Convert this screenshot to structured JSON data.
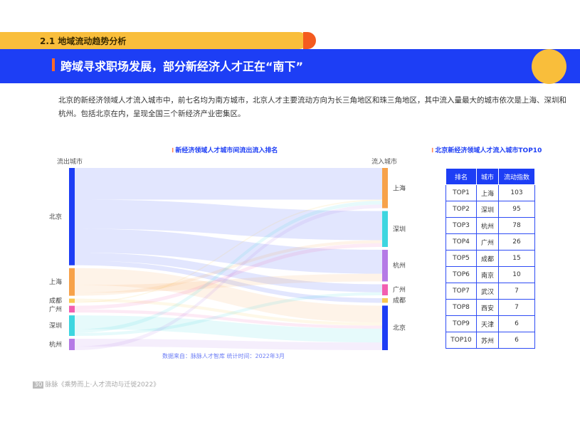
{
  "section": {
    "title": "2.1 地域流动趋势分析"
  },
  "banner": {
    "title": "跨域寻求职场发展，部分新经济人才正在“南下”"
  },
  "intro": "北京的新经济领域人才流入城市中，前七名均为南方城市，北京人才主要流动方向为长三角地区和珠三角地区，其中流入量最大的城市依次是上海、深圳和杭州。包括北京在内，呈现全国三个新经济产业密集区。",
  "sankey_panel": {
    "title": "新经济领域人才城市间流出流入排名",
    "left_head": "流出城市",
    "right_head": "流入城市",
    "source": "数据来自：脉脉人才智库   统计时间：2022年3月"
  },
  "table_panel": {
    "title": "北京新经济领域人才流入城市TOP10",
    "headers": [
      "排名",
      "城市",
      "流动指数"
    ],
    "rows": [
      [
        "TOP1",
        "上海",
        "103"
      ],
      [
        "TOP2",
        "深圳",
        "95"
      ],
      [
        "TOP3",
        "杭州",
        "78"
      ],
      [
        "TOP4",
        "广州",
        "26"
      ],
      [
        "TOP5",
        "成都",
        "15"
      ],
      [
        "TOP6",
        "南京",
        "10"
      ],
      [
        "TOP7",
        "武汉",
        "7"
      ],
      [
        "TOP8",
        "西安",
        "7"
      ],
      [
        "TOP9",
        "天津",
        "6"
      ],
      [
        "TOP10",
        "苏州",
        "6"
      ]
    ]
  },
  "footer": {
    "page": "30",
    "text": "脉脉《乘势而上·人才流动与迁徙2022》"
  },
  "chart_data": {
    "type": "sankey",
    "left_nodes": [
      {
        "name": "北京",
        "color": "#1d3ef5"
      },
      {
        "name": "上海",
        "color": "#f7a24a"
      },
      {
        "name": "成都",
        "color": "#f9c74f"
      },
      {
        "name": "广州",
        "color": "#f25eb0"
      },
      {
        "name": "深圳",
        "color": "#3dd6e0"
      },
      {
        "name": "杭州",
        "color": "#b57ae6"
      }
    ],
    "right_nodes": [
      {
        "name": "上海",
        "color": "#f7a24a"
      },
      {
        "name": "深圳",
        "color": "#3dd6e0"
      },
      {
        "name": "杭州",
        "color": "#b57ae6"
      },
      {
        "name": "广州",
        "color": "#f25eb0"
      },
      {
        "name": "成都",
        "color": "#f9c74f"
      },
      {
        "name": "北京",
        "color": "#1d3ef5"
      }
    ],
    "links": [
      {
        "source": "北京",
        "target": "上海",
        "value": 103
      },
      {
        "source": "北京",
        "target": "深圳",
        "value": 95
      },
      {
        "source": "北京",
        "target": "杭州",
        "value": 78
      },
      {
        "source": "北京",
        "target": "广州",
        "value": 26
      },
      {
        "source": "北京",
        "target": "成都",
        "value": 15
      },
      {
        "source": "上海",
        "target": "北京",
        "value": 55
      },
      {
        "source": "上海",
        "target": "杭州",
        "value": 25
      },
      {
        "source": "上海",
        "target": "深圳",
        "value": 10
      },
      {
        "source": "成都",
        "target": "北京",
        "value": 10
      },
      {
        "source": "成都",
        "target": "上海",
        "value": 4
      },
      {
        "source": "广州",
        "target": "深圳",
        "value": 12
      },
      {
        "source": "广州",
        "target": "北京",
        "value": 10
      },
      {
        "source": "深圳",
        "target": "北京",
        "value": 45
      },
      {
        "source": "深圳",
        "target": "上海",
        "value": 12
      },
      {
        "source": "深圳",
        "target": "广州",
        "value": 10
      },
      {
        "source": "杭州",
        "target": "北京",
        "value": 25
      },
      {
        "source": "杭州",
        "target": "上海",
        "value": 12
      }
    ]
  }
}
